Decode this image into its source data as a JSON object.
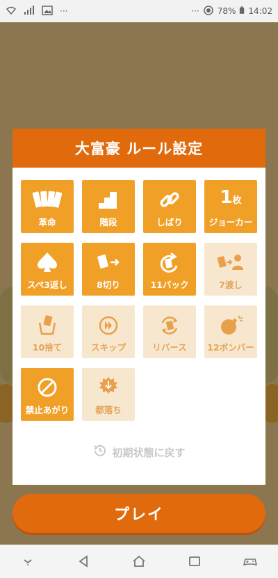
{
  "status_bar": {
    "overflow": "···",
    "battery": "78%",
    "time": "14:02",
    "icons": [
      "wifi-icon",
      "signal-icon",
      "image-icon",
      "dnd-icon",
      "battery-icon"
    ]
  },
  "modal": {
    "title": "大富豪 ルール設定",
    "rules": [
      {
        "label": "革命",
        "enabled": true,
        "icon": "cards-icon"
      },
      {
        "label": "階段",
        "enabled": true,
        "icon": "stairs-icon"
      },
      {
        "label": "しばり",
        "enabled": true,
        "icon": "chain-link-icon"
      },
      {
        "label": "ジョーカー",
        "enabled": true,
        "icon": "one-count-icon",
        "icon_text": "1",
        "icon_text_small": "枚"
      },
      {
        "label": "スペ3返し",
        "enabled": true,
        "icon": "spade-icon"
      },
      {
        "label": "8切り",
        "enabled": true,
        "icon": "card-cut-icon"
      },
      {
        "label": "11バック",
        "enabled": true,
        "icon": "back-arrow-icon"
      },
      {
        "label": "7渡し",
        "enabled": false,
        "icon": "pass-card-icon"
      },
      {
        "label": "10捨て",
        "enabled": false,
        "icon": "discard-icon"
      },
      {
        "label": "スキップ",
        "enabled": false,
        "icon": "skip-icon"
      },
      {
        "label": "リバース",
        "enabled": false,
        "icon": "reverse-icon"
      },
      {
        "label": "12ボンバー",
        "enabled": false,
        "icon": "bomb-icon"
      },
      {
        "label": "禁止あがり",
        "enabled": true,
        "icon": "prohibited-icon"
      },
      {
        "label": "都落ち",
        "enabled": false,
        "icon": "fall-icon"
      }
    ],
    "reset_label": "初期状態に戻す"
  },
  "play_button": {
    "label": "プレイ"
  },
  "navbar": {
    "icons": [
      "down-chevron-icon",
      "back-icon",
      "home-icon",
      "recents-icon",
      "gamepad-icon"
    ]
  },
  "colors": {
    "accent": "#e06a0c",
    "tile_on": "#f1a027",
    "tile_off": "#f8e7cf"
  }
}
